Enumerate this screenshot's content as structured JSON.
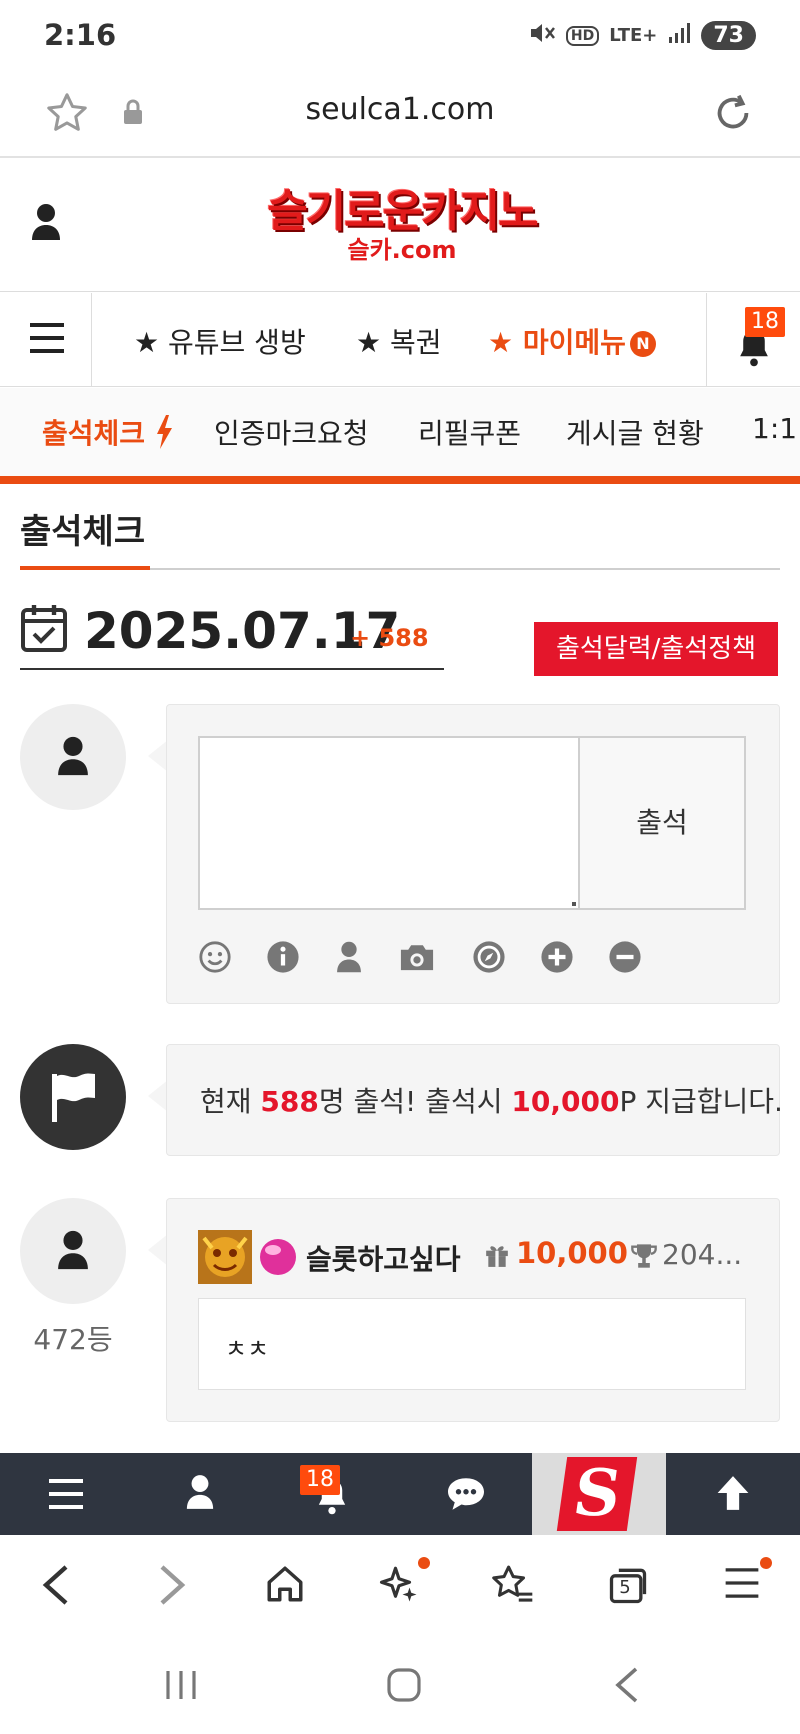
{
  "status_bar": {
    "time": "2:16",
    "network": "LTE+",
    "battery": "73"
  },
  "url_bar": {
    "url": "seulca1.com"
  },
  "header": {
    "logo_main": "슬기로운카지노",
    "logo_sub": "슬카.com"
  },
  "main_nav": {
    "items": [
      {
        "label": "★ 유튜브 생방"
      },
      {
        "label": "★ 복권"
      },
      {
        "label": "★ 마이메뉴"
      }
    ],
    "new_badge": "N",
    "notification_count": "18"
  },
  "sub_nav": {
    "items": [
      {
        "label": "출석체크"
      },
      {
        "label": "인증마크요청"
      },
      {
        "label": "리필쿠폰"
      },
      {
        "label": "게시글 현황"
      },
      {
        "label": "1:1"
      }
    ]
  },
  "page": {
    "title": "출석체크",
    "date": "2025.07.17",
    "date_plus": "+ 588",
    "policy_button": "출석달력/출석정책",
    "submit_button": "출석"
  },
  "notice": {
    "prefix": "현재 ",
    "count": "588",
    "middle": "명 출석! 출석시 ",
    "points": "10,000",
    "suffix": "P 지급합니다."
  },
  "entry": {
    "rank": "472등",
    "user_name": "슬롯하고싶다",
    "points": "10,000",
    "trophy": "204...",
    "comment": "ㅊㅊ"
  },
  "bottom_bar": {
    "notification_count": "18",
    "logo_letter": "S"
  },
  "browser_toolbar": {
    "tab_count": "5"
  },
  "colors": {
    "accent": "#ea4c12",
    "red": "#e4162b",
    "dark_bar": "#2f3540"
  }
}
